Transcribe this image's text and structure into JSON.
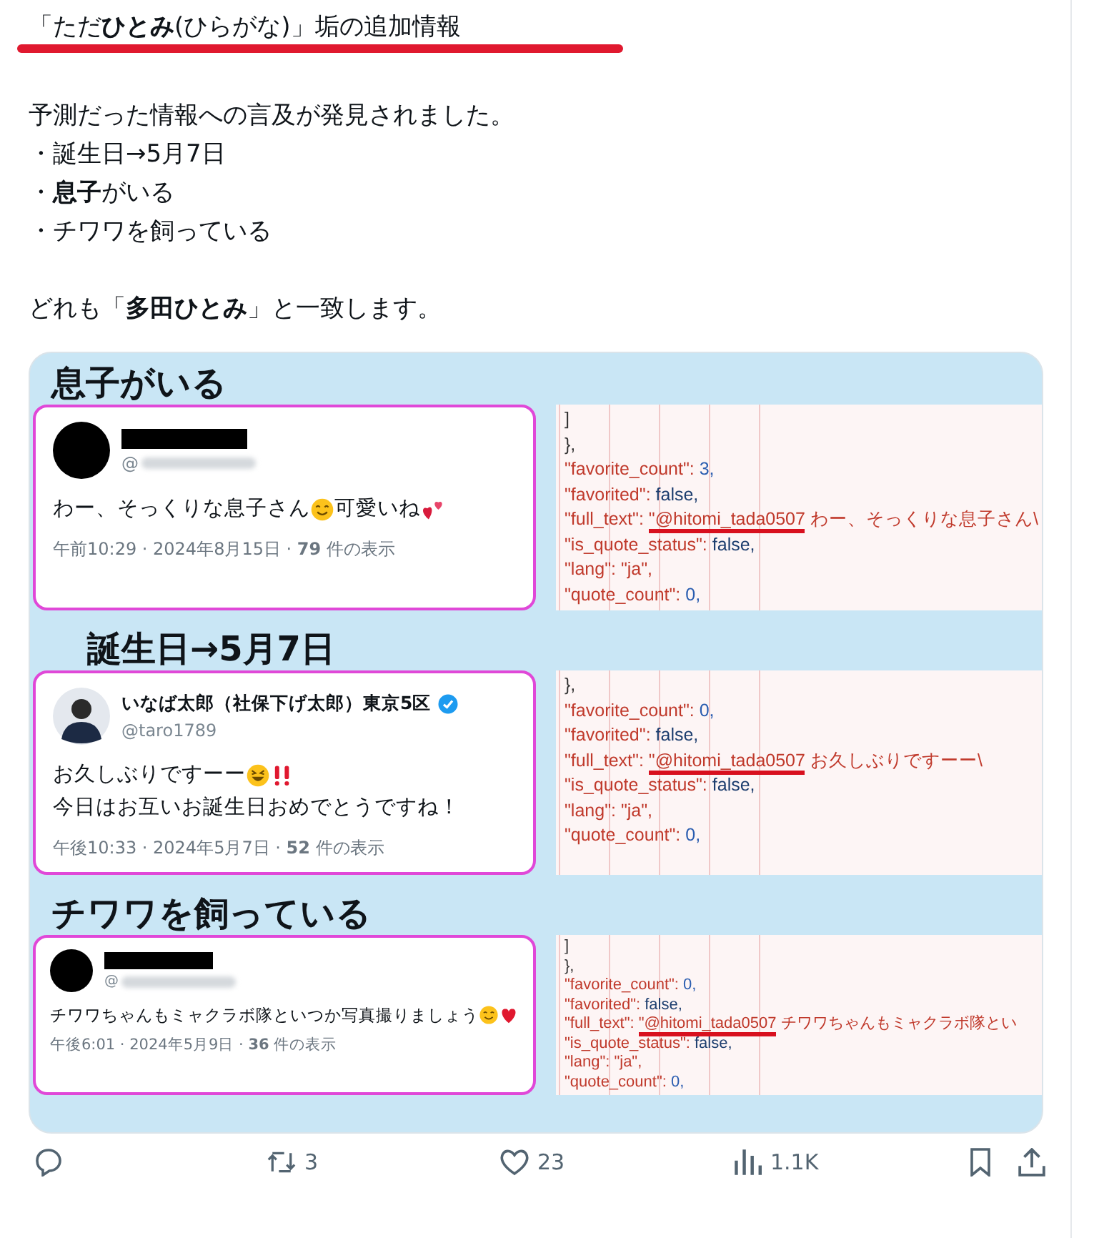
{
  "post": {
    "title": "「ただ**ひとみ**(ひらがな)」垢の追加情報",
    "body": [
      "予測だった情報への言及が発見されました。",
      "・誕生日→5月7日",
      "・**息子**がいる",
      "・チワワを飼っている"
    ],
    "closing": "どれも「**多田ひとみ**」と一致します。"
  },
  "image": {
    "panels": [
      {
        "heading": "息子がいる",
        "indent": false,
        "author": {
          "kind": "redacted",
          "handle": "@"
        },
        "text": [
          [
            {
              "kind": "text",
              "text": "わー、そっくりな息子さん"
            },
            {
              "kind": "smile"
            },
            {
              "kind": "text",
              "text": "可愛いね"
            },
            {
              "kind": "hearts"
            }
          ]
        ],
        "meta": "午前10:29 · 2024年8月15日 · **79** 件の表示",
        "code": [
          {
            "kind": "punct",
            "value": "]"
          },
          {
            "kind": "punct",
            "value": "},"
          },
          {
            "kind": "number",
            "key": "\"favorite_count\": ",
            "value": "3,"
          },
          {
            "kind": "literal",
            "key": "\"favorited\": ",
            "value": "false,"
          },
          {
            "kind": "mention",
            "key": "\"full_text\": ",
            "mention": "\"@hitomi_tada0507",
            "value": " わー、そっくりな息子さん\\"
          },
          {
            "kind": "literal",
            "key": "\"is_quote_status\": ",
            "value": "false,"
          },
          {
            "kind": "string",
            "key": "\"lang\": ",
            "value": "\"ja\","
          },
          {
            "kind": "number",
            "key": "\"quote_count\": ",
            "value": "0,"
          }
        ]
      },
      {
        "heading": "誕生日→5月7日",
        "indent": true,
        "author": {
          "kind": "person",
          "name": "いなば太郎（社保下げ太郎）東京5区",
          "handle": "@taro1789",
          "verified": true
        },
        "text": [
          [
            {
              "kind": "text",
              "text": "お久しぶりですーー"
            },
            {
              "kind": "grin"
            },
            {
              "kind": "bang"
            }
          ],
          [
            {
              "kind": "text",
              "text": "今日はお互いお誕生日おめでとうですね！"
            }
          ]
        ],
        "meta": "午後10:33 · 2024年5月7日 · **52** 件の表示",
        "code": [
          {
            "kind": "punct",
            "value": "},"
          },
          {
            "kind": "number",
            "key": "\"favorite_count\": ",
            "value": "0,"
          },
          {
            "kind": "literal",
            "key": "\"favorited\": ",
            "value": "false,"
          },
          {
            "kind": "mention",
            "key": "\"full_text\": ",
            "mention": "\"@hitomi_tada0507",
            "value": " お久しぶりですーー\\"
          },
          {
            "kind": "literal",
            "key": "\"is_quote_status\": ",
            "value": "false,"
          },
          {
            "kind": "string",
            "key": "\"lang\": ",
            "value": "\"ja\","
          },
          {
            "kind": "number",
            "key": "\"quote_count\": ",
            "value": "0,"
          }
        ]
      },
      {
        "heading": "チワワを飼っている",
        "indent": false,
        "author": {
          "kind": "redacted",
          "handle": "@"
        },
        "text": [
          [
            {
              "kind": "text",
              "text": "チワワちゃんもミャクラボ隊といつか写真撮りましょう"
            },
            {
              "kind": "smile"
            },
            {
              "kind": "heart"
            }
          ]
        ],
        "meta": "午後6:01 · 2024年5月9日 · **36** 件の表示",
        "code": [
          {
            "kind": "punct",
            "value": "]"
          },
          {
            "kind": "punct",
            "value": "},"
          },
          {
            "kind": "number",
            "key": "\"favorite_count\": ",
            "value": "0,"
          },
          {
            "kind": "literal",
            "key": "\"favorited\": ",
            "value": "false,"
          },
          {
            "kind": "mention",
            "key": "\"full_text\": ",
            "mention": "\"@hitomi_tada0507",
            "value": " チワワちゃんもミャクラボ隊とい"
          },
          {
            "kind": "literal",
            "key": "\"is_quote_status\": ",
            "value": "false,"
          },
          {
            "kind": "string",
            "key": "\"lang\": ",
            "value": "\"ja\","
          },
          {
            "kind": "number",
            "key": "\"quote_count\": ",
            "value": "0,"
          }
        ]
      }
    ]
  },
  "actions": [
    {
      "kind": "reply"
    },
    {
      "kind": "repost",
      "count": "3"
    },
    {
      "kind": "like",
      "count": "23"
    },
    {
      "kind": "views",
      "count": "1.1K"
    },
    {
      "kind": "bookmark"
    },
    {
      "kind": "share"
    }
  ]
}
